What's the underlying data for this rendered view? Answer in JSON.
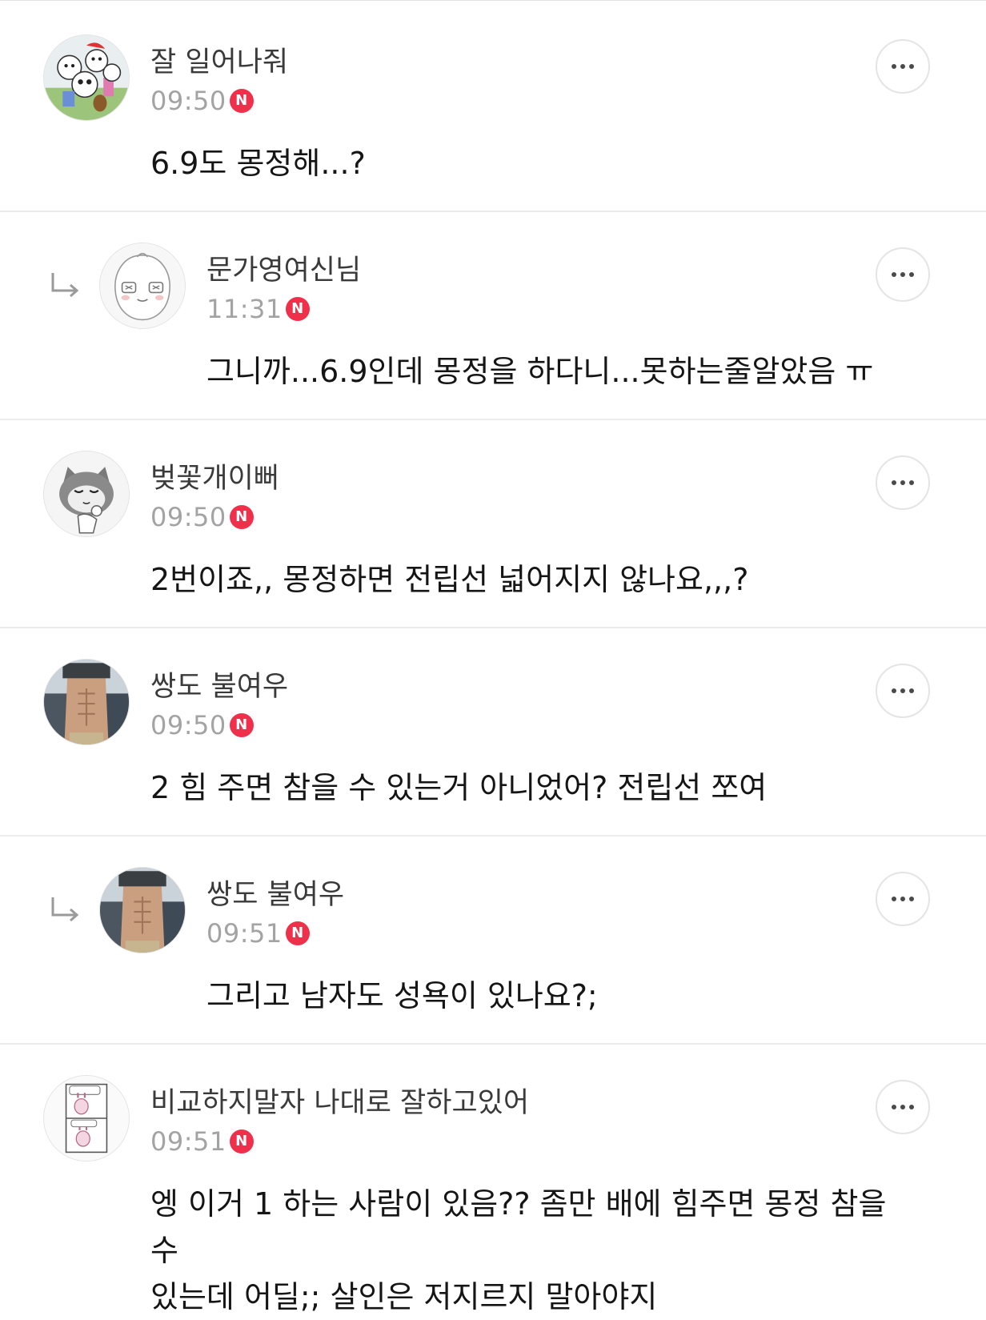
{
  "comments": [
    {
      "author": "잘 일어나줘",
      "time": "09:50",
      "badge": "N",
      "text": "6.9도 몽정해...?",
      "avatar": "cartoon-dogs-avatar"
    },
    {
      "author": "문가영여신님",
      "time": "11:31",
      "badge": "N",
      "text": "그니까...6.9인데 몽정을 하다니...못하는줄알았음 ㅠ",
      "avatar": "peach-character-avatar"
    },
    {
      "author": "벚꽃개이뻐",
      "time": "09:50",
      "badge": "N",
      "text": "2번이죠,, 몽정하면 전립선 넓어지지 않나요,,,?",
      "avatar": "gray-cat-avatar"
    },
    {
      "author": "쌍도 불여우",
      "time": "09:50",
      "badge": "N",
      "text": "2 힘 주면 참을 수 있는거 아니었어? 전립선 쪼여",
      "avatar": "abs-photo-avatar"
    },
    {
      "author": "쌍도 불여우",
      "time": "09:51",
      "badge": "N",
      "text": "그리고 남자도 성욕이 있나요?;",
      "avatar": "abs-photo-avatar"
    },
    {
      "author": "비교하지말자 나대로 잘하고있어",
      "time": "09:51",
      "badge": "N",
      "text": "엥 이거 1 하는 사람이 있음?? 좀만 배에 힘주면 몽정 참을 수\n있는데 어딜;; 살인은 저지르지 말아야지",
      "avatar": "comic-bunny-avatar"
    }
  ],
  "icons": {
    "more": "more-options-icon",
    "reply": "reply-arrow-icon",
    "new": "new-badge-icon"
  },
  "colors": {
    "badge": "#f0304a",
    "time": "#a3a3a3",
    "divider": "#ececec"
  }
}
